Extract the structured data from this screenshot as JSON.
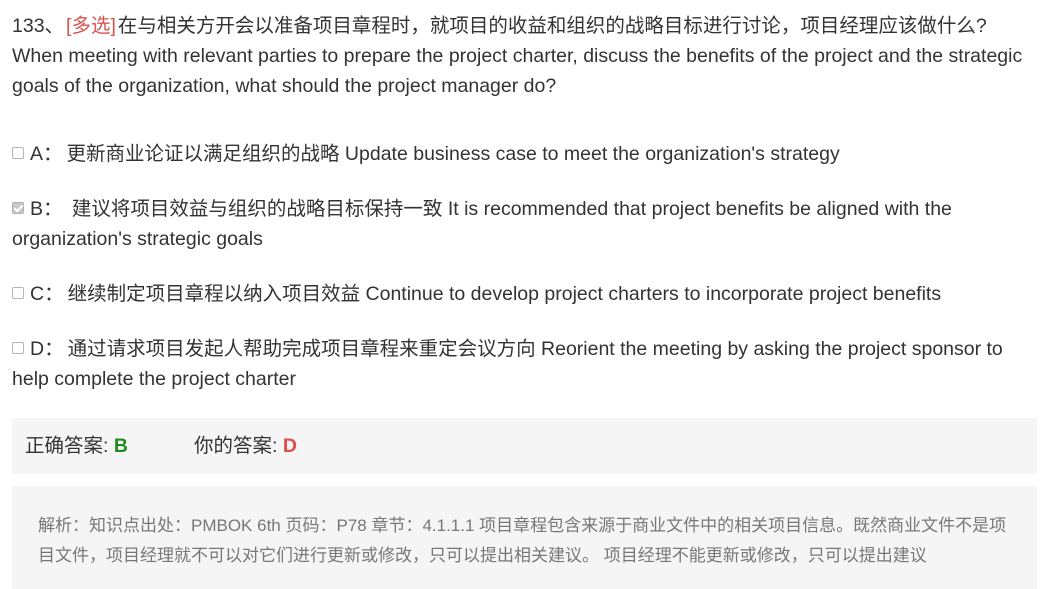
{
  "question": {
    "number": "133、",
    "type_label": "[多选]",
    "text_cn": "在与相关方开会以准备项目章程时，就项目的收益和组织的战略目标进行讨论，项目经理应该做什么?",
    "text_en": "When meeting with relevant parties to prepare the project charter, discuss the benefits of the project and the strategic goals of the organization, what should the project manager do?"
  },
  "options": [
    {
      "letter": "A：",
      "text": "更新商业论证以满足组织的战略 Update business case to meet the organization's strategy",
      "checked": false
    },
    {
      "letter": "B：",
      "text": " 建议将项目效益与组织的战略目标保持一致 It is recommended that project benefits be aligned with the organization's strategic goals",
      "checked": true
    },
    {
      "letter": "C：",
      "text": "继续制定项目章程以纳入项目效益 Continue to develop project charters to incorporate project benefits",
      "checked": false
    },
    {
      "letter": "D：",
      "text": "通过请求项目发起人帮助完成项目章程来重定会议方向 Reorient the meeting by asking the project sponsor to help complete the project charter",
      "checked": false
    }
  ],
  "answer": {
    "correct_label": "正确答案:",
    "correct_value": "B",
    "yours_label": "你的答案:",
    "yours_value": "D"
  },
  "analysis": {
    "text": "解析：知识点出处：PMBOK 6th 页码：P78 章节：4.1.1.1 项目章程包含来源于商业文件中的相关项目信息。既然商业文件不是项目文件，项目经理就不可以对它们进行更新或修改，只可以提出相关建议。 项目经理不能更新或修改，只可以提出建议"
  },
  "colors": {
    "question_type": "#d9534f",
    "correct_answer": "#1f8a1f",
    "your_answer": "#e04c4c",
    "panel_background": "#f5f5f5",
    "analysis_text": "#777777"
  }
}
